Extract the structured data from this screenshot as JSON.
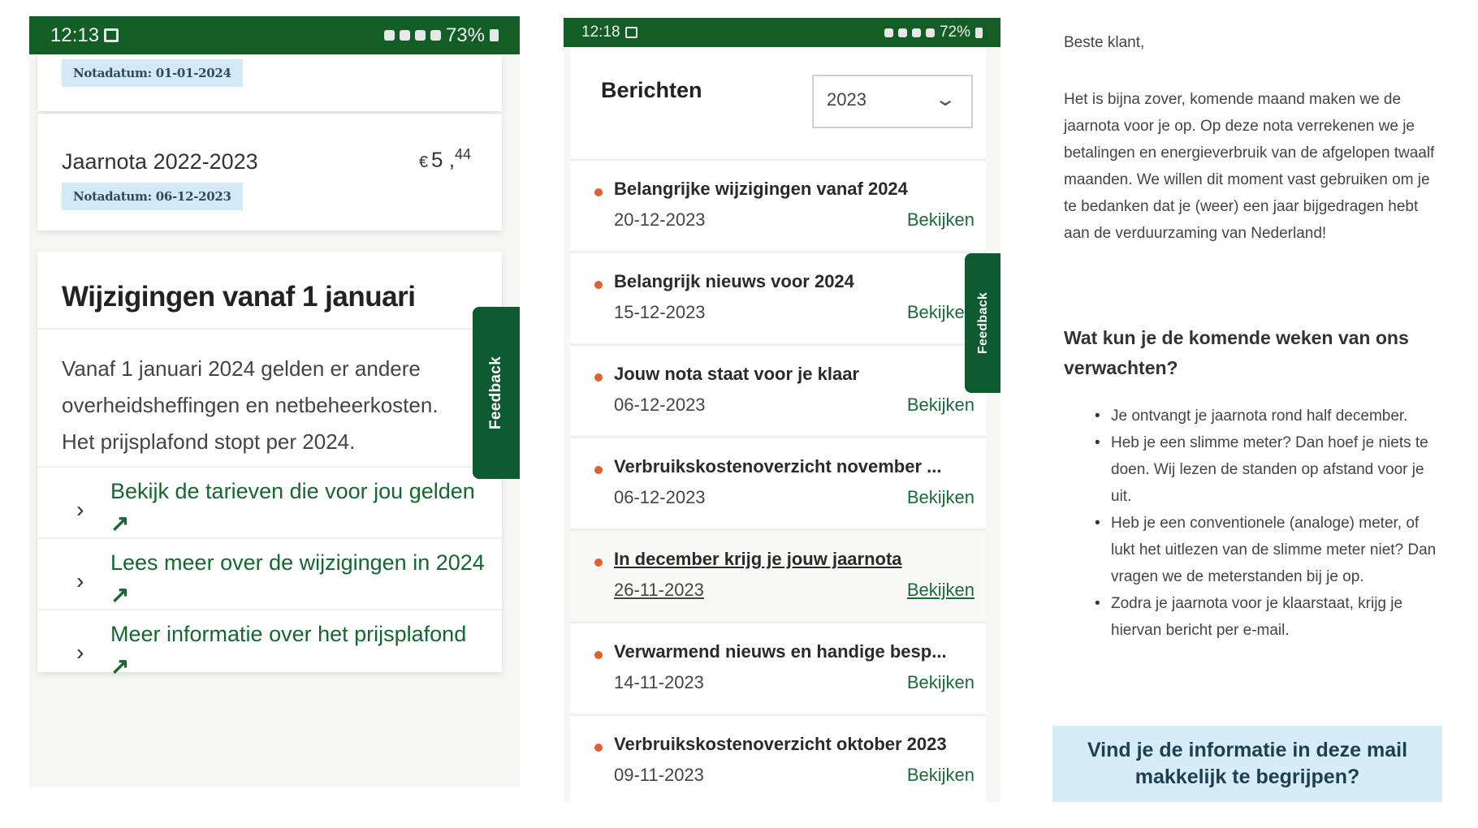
{
  "panel1": {
    "status": {
      "time": "12:13",
      "battery": "73%"
    },
    "prev_badge": "Notadatum: 01-01-2024",
    "jaarnota": {
      "title": "Jaarnota 2022-2023",
      "currency": "€",
      "amount_whole": "5 ,",
      "amount_cents": "44",
      "badge": "Notadatum: 06-12-2023"
    },
    "changes": {
      "title": "Wijzigingen vanaf 1 januari",
      "body_lines": [
        "Vanaf 1 januari 2024 gelden er andere",
        "overheidsheffingen en netbeheerkosten.",
        "Het prijsplafond stopt per 2024."
      ],
      "links": [
        {
          "label": "Bekijk de tarieven die voor jou gelden"
        },
        {
          "label": "Lees meer over de wijzigingen in 2024"
        },
        {
          "label": "Meer informatie over het prijsplafond"
        }
      ]
    },
    "feedback_label": "Feedback"
  },
  "panel2": {
    "status": {
      "time": "12:18",
      "battery": "72%"
    },
    "title": "Berichten",
    "year_selected": "2023",
    "feedback_label": "Feedback",
    "link_label": "Bekijken",
    "messages": [
      {
        "title": "Belangrijke wijzigingen vanaf 2024",
        "date": "20-12-2023"
      },
      {
        "title": "Belangrijk nieuws voor 2024",
        "date": "15-12-2023"
      },
      {
        "title": "Jouw nota staat voor je klaar",
        "date": "06-12-2023"
      },
      {
        "title": "Verbruikskostenoverzicht november ...",
        "date": "06-12-2023"
      },
      {
        "title": "In december krijg je jouw jaarnota",
        "date": "26-11-2023"
      },
      {
        "title": "Verwarmend nieuws en handige besp...",
        "date": "14-11-2023"
      },
      {
        "title": "Verbruikskostenoverzicht oktober 2023",
        "date": "09-11-2023"
      }
    ],
    "colors": {
      "accent_green": "#135d26",
      "bullet_orange": "#e2602f"
    }
  },
  "panel3": {
    "greeting": "Beste klant,",
    "body": "Het is bijna zover, komende maand maken we de jaarnota voor je op. Op deze nota verrekenen we je betalingen en energieverbruik van de afgelopen twaalf maanden. We willen dit moment vast gebruiken om je te bedanken dat je (weer) een jaar bijgedragen hebt aan de verduurzaming van Nederland!",
    "question_heading": "Wat kun je de komende weken van ons verwachten?",
    "bullets": [
      "Je ontvangt je jaarnota rond half december.",
      "Heb je een slimme meter? Dan hoef je niets te doen. Wij lezen de standen op afstand voor je uit.",
      "Heb je een conventionele (analoge) meter, of lukt het uitlezen van de slimme meter niet? Dan vragen we de meterstanden bij je op.",
      "Zodra je jaarnota voor je klaarstaat, krijg je hiervan bericht per e-mail."
    ],
    "cta": "Vind je de informatie in deze mail makkelijk te begrijpen?"
  }
}
